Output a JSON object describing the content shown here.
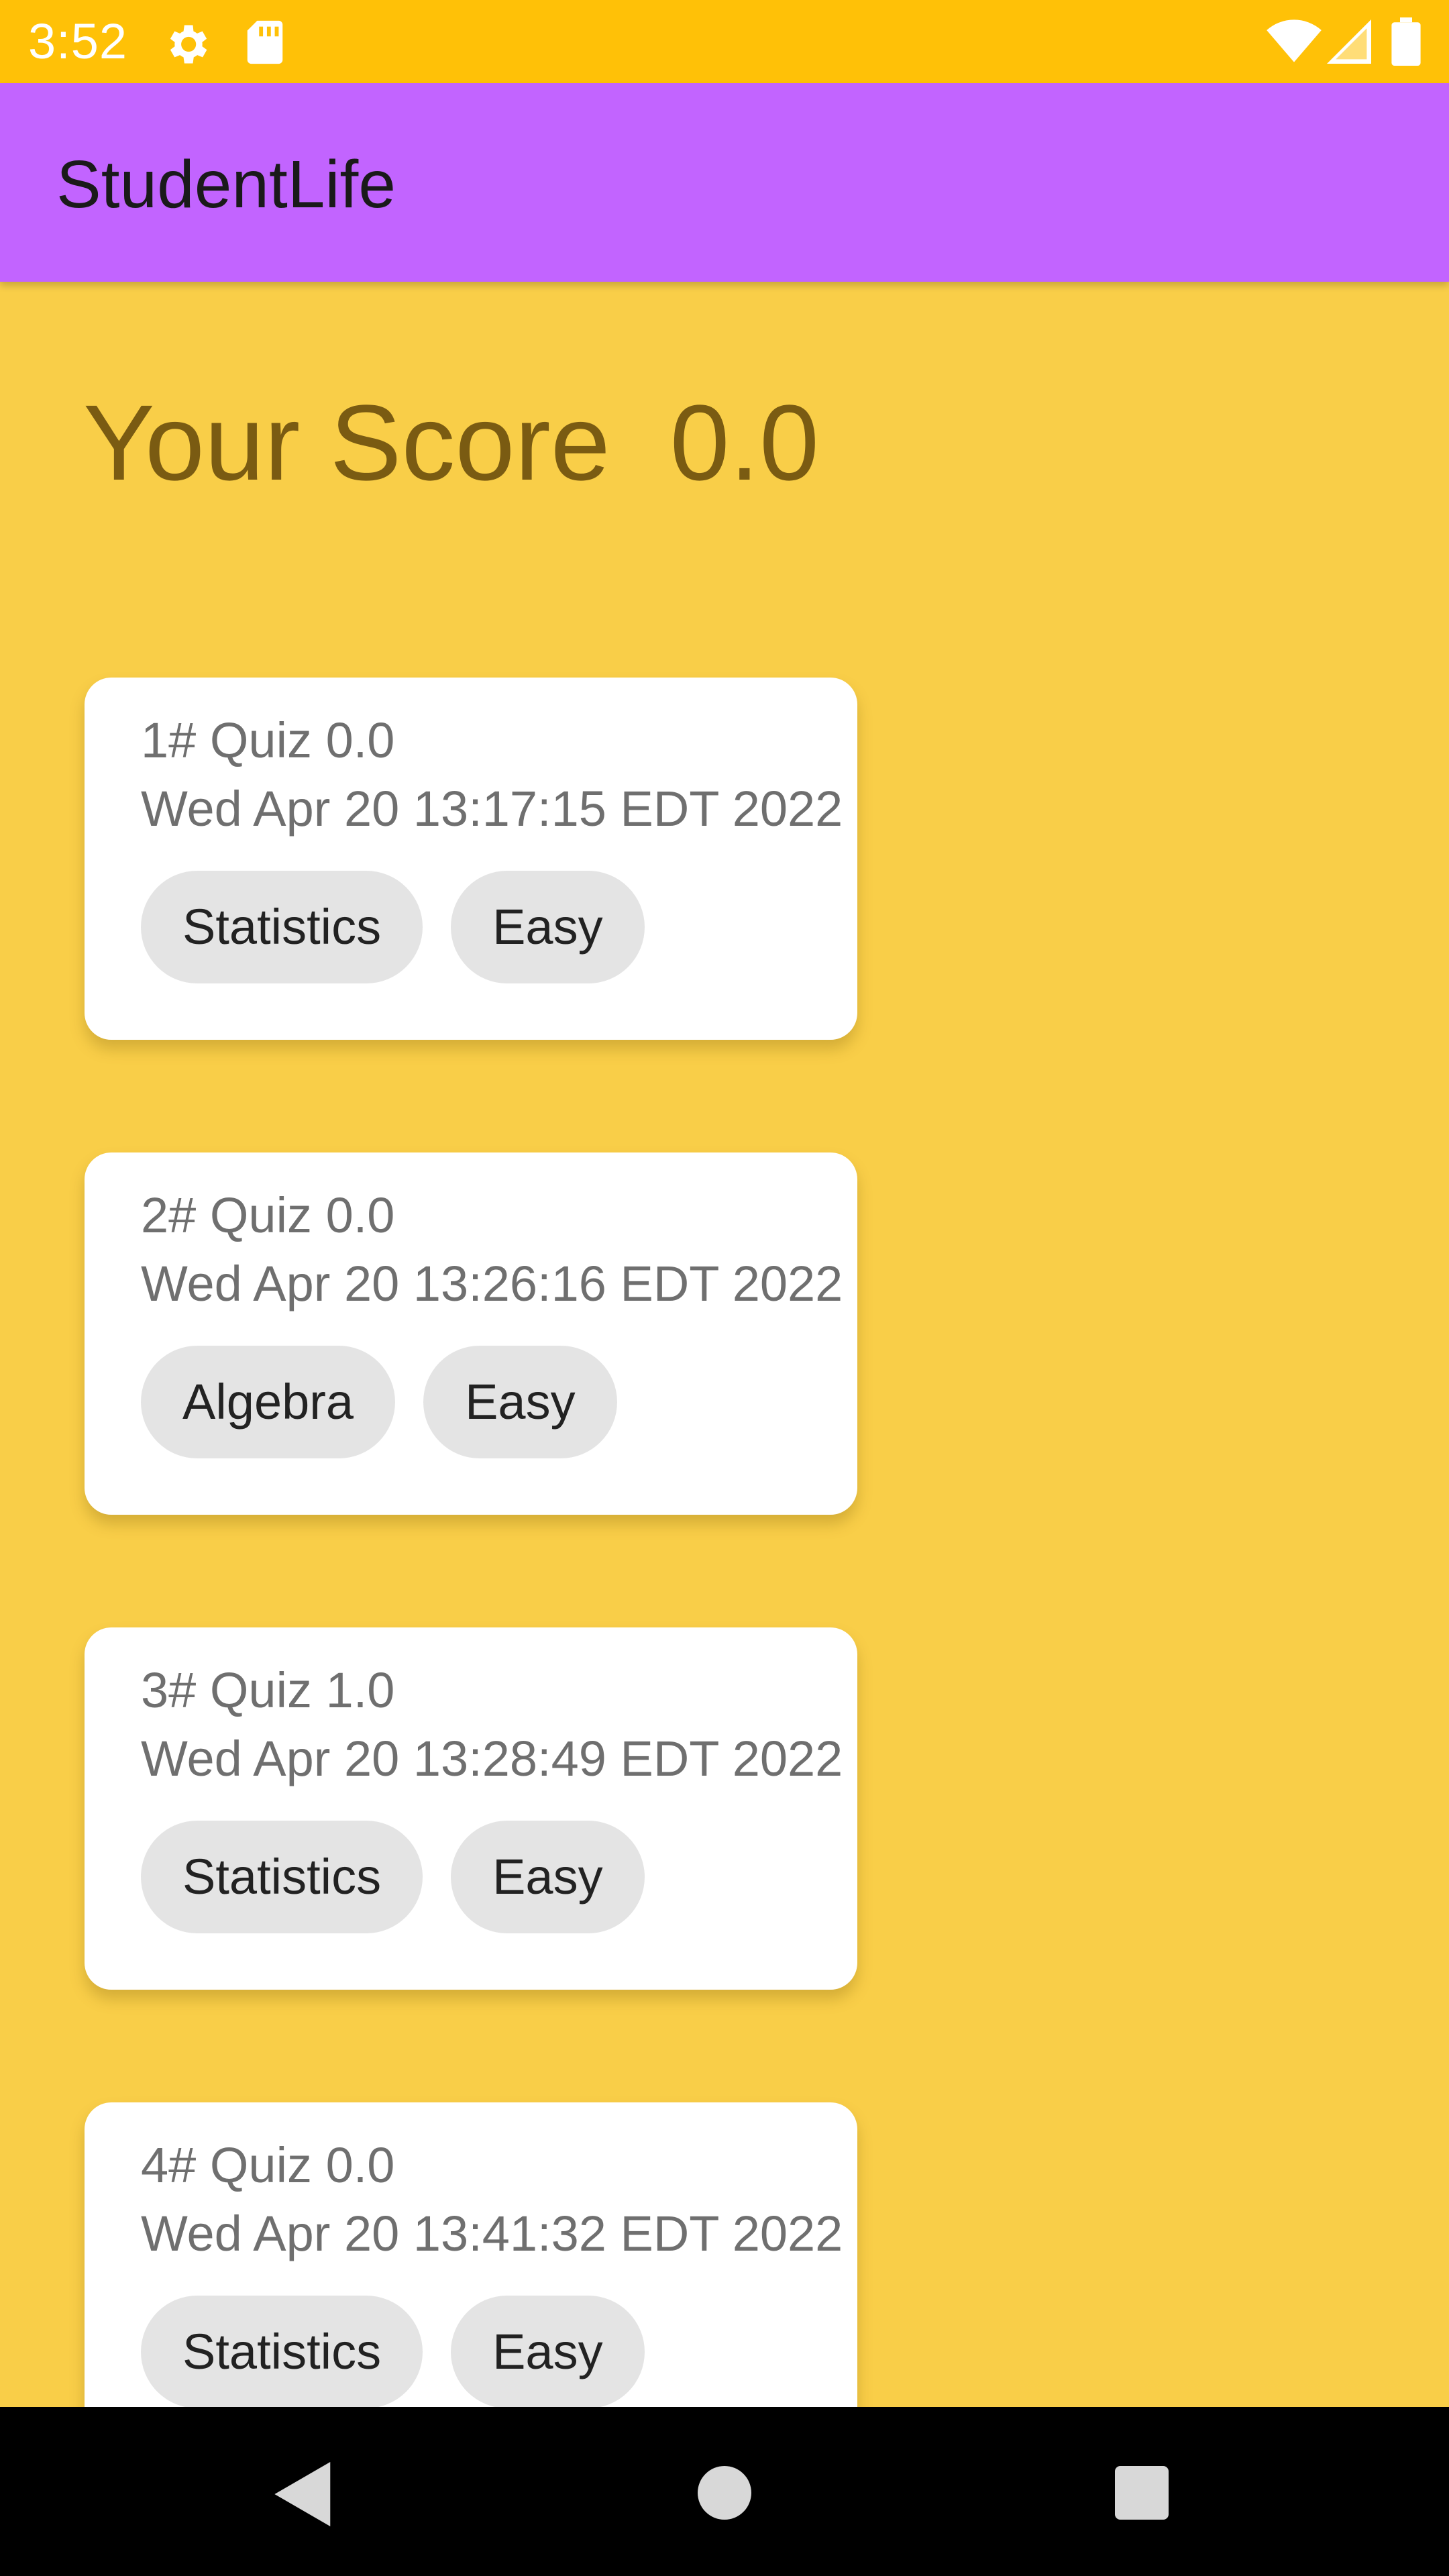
{
  "status_bar": {
    "time": "3:52",
    "icons": [
      "settings-gear-icon",
      "sd-card-icon",
      "wifi-icon",
      "cellular-signal-icon",
      "battery-icon"
    ]
  },
  "app_bar": {
    "title": "StudentLife"
  },
  "score": {
    "label": "Your Score  0.0"
  },
  "quizzes": [
    {
      "title": "1# Quiz 0.0",
      "date": "Wed Apr 20 13:17:15 EDT 2022",
      "topic": "Statistics",
      "difficulty": "Easy"
    },
    {
      "title": "2# Quiz 0.0",
      "date": "Wed Apr 20 13:26:16 EDT 2022",
      "topic": "Algebra",
      "difficulty": "Easy"
    },
    {
      "title": "3# Quiz 1.0",
      "date": "Wed Apr 20 13:28:49 EDT 2022",
      "topic": "Statistics",
      "difficulty": "Easy"
    },
    {
      "title": "4# Quiz 0.0",
      "date": "Wed Apr 20 13:41:32 EDT 2022",
      "topic": "Statistics",
      "difficulty": "Easy"
    }
  ],
  "nav_bar": {
    "icons": [
      "back-icon",
      "home-icon",
      "recents-icon"
    ]
  },
  "colors": {
    "status_bar": "#ffc107",
    "app_bar": "#c264ff",
    "background": "#f9ce48",
    "score_text": "#7a5b12",
    "card": "#ffffff",
    "chip": "#e4e4e4"
  }
}
